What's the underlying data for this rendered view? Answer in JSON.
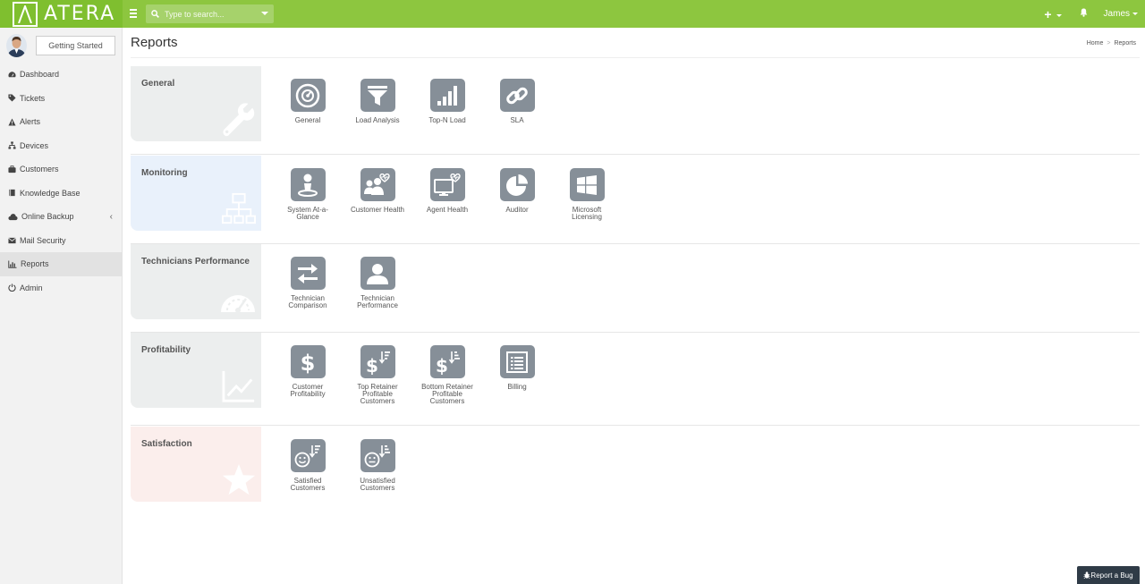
{
  "app": {
    "logo_text": "ATERA"
  },
  "topbar": {
    "search_placeholder": "Type to search...",
    "plus": "+",
    "user_name": "James"
  },
  "sidebar": {
    "getting_started": "Getting Started",
    "items": [
      {
        "label": "Dashboard",
        "icon": "dashboard-icon"
      },
      {
        "label": "Tickets",
        "icon": "tag-icon"
      },
      {
        "label": "Alerts",
        "icon": "warning-icon"
      },
      {
        "label": "Devices",
        "icon": "sitemap-icon"
      },
      {
        "label": "Customers",
        "icon": "briefcase-icon"
      },
      {
        "label": "Knowledge Base",
        "icon": "book-icon"
      },
      {
        "label": "Online Backup",
        "icon": "cloud-icon",
        "chevron": "‹"
      },
      {
        "label": "Mail Security",
        "icon": "envelope-icon"
      },
      {
        "label": "Reports",
        "icon": "bar-chart-icon",
        "active": true
      },
      {
        "label": "Admin",
        "icon": "power-icon"
      }
    ]
  },
  "header": {
    "title": "Reports",
    "breadcrumb": [
      "Home",
      "Reports"
    ],
    "breadcrumb_sep": ">"
  },
  "sections": [
    {
      "title": "General",
      "bg": "#eceeee",
      "bg_icon": "wrench-icon",
      "reports": [
        {
          "label": "General",
          "icon": "dashboard-icon"
        },
        {
          "label": "Load Analysis",
          "icon": "filter-icon"
        },
        {
          "label": "Top-N Load",
          "icon": "signal-icon"
        },
        {
          "label": "SLA",
          "icon": "link-icon"
        }
      ]
    },
    {
      "title": "Monitoring",
      "bg": "#e9f1fb",
      "bg_icon": "sitemap-icon",
      "reports": [
        {
          "label": "System At-a-Glance",
          "icon": "user-pin-icon"
        },
        {
          "label": "Customer Health",
          "icon": "group-heart-icon"
        },
        {
          "label": "Agent Health",
          "icon": "monitor-heart-icon"
        },
        {
          "label": "Auditor",
          "icon": "pie-icon"
        },
        {
          "label": "Microsoft Licensing",
          "icon": "windows-icon"
        }
      ]
    },
    {
      "title": "Technicians Performance",
      "bg": "#eceeee",
      "bg_icon": "speedometer-icon",
      "reports": [
        {
          "label": "Technician Comparison",
          "icon": "exchange-icon"
        },
        {
          "label": "Technician Performance",
          "icon": "user-icon"
        }
      ]
    },
    {
      "title": "Profitability",
      "bg": "#eceeee",
      "bg_icon": "line-chart-icon",
      "reports": [
        {
          "label": "Customer Profitability",
          "icon": "dollar-icon"
        },
        {
          "label": "Top Retainer Profitable Customers",
          "icon": "dollar-sort-up-icon"
        },
        {
          "label": "Bottom Retainer Profitable Customers",
          "icon": "dollar-sort-down-icon"
        },
        {
          "label": "Billing",
          "icon": "list-icon"
        }
      ]
    },
    {
      "title": "Satisfaction",
      "bg": "#fbeeec",
      "bg_icon": "star-icon",
      "reports": [
        {
          "label": "Satisfied Customers",
          "icon": "smile-sort-up-icon"
        },
        {
          "label": "Unsatisfied Customers",
          "icon": "smile-sort-down-icon"
        }
      ]
    }
  ],
  "footer": {
    "report_bug": "Report a Bug"
  },
  "colors": {
    "brand_green": "#8dc63f",
    "tile_gray": "#868f98",
    "bug_button": "#2f3b47"
  }
}
